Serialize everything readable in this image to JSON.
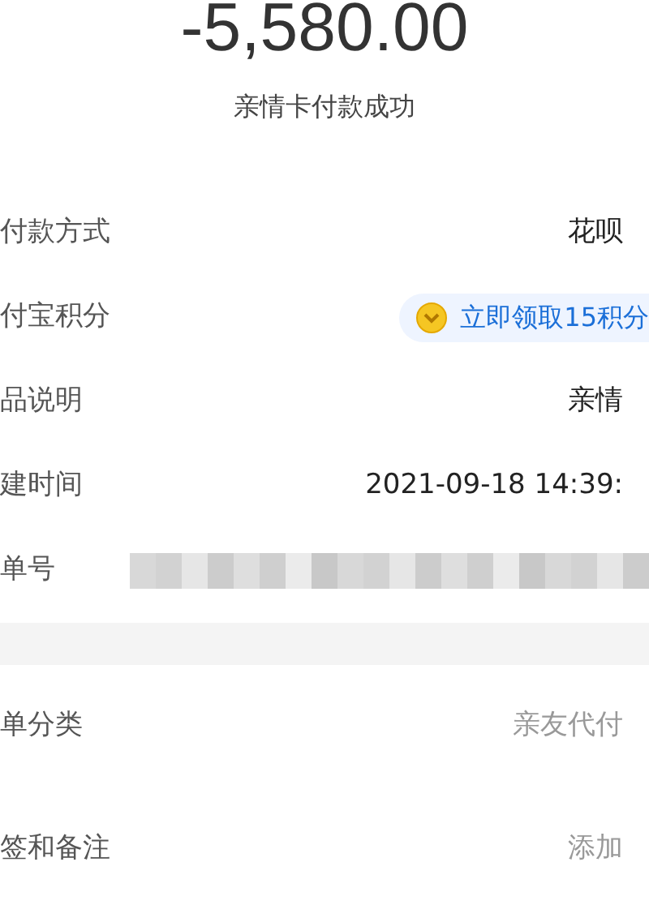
{
  "amount": "-5,580.00",
  "status": "亲情卡付款成功",
  "details": [
    {
      "label": "付款方式",
      "value": "花呗",
      "kind": "text"
    },
    {
      "label": "付宝积分",
      "value": "立即领取15积分",
      "kind": "points"
    },
    {
      "label": "品说明",
      "value": "亲情",
      "kind": "text"
    },
    {
      "label": "建时间",
      "value": "2021-09-18 14:39:",
      "kind": "text"
    },
    {
      "label": "单号",
      "kind": "redacted"
    }
  ],
  "extras": [
    {
      "label": "单分类",
      "value": "亲友代付"
    },
    {
      "label": "签和备注",
      "value": "添加"
    }
  ]
}
